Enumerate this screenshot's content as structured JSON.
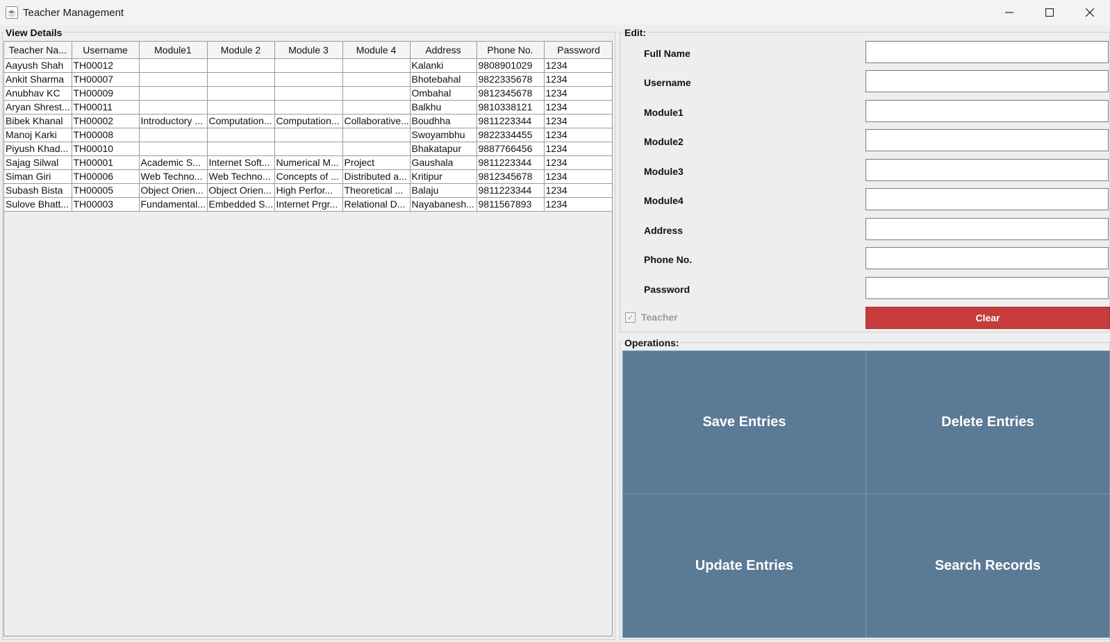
{
  "window": {
    "title": "Teacher Management",
    "app_icon": "java-cup-icon",
    "controls": [
      "minimize-icon",
      "maximize-icon",
      "close-icon"
    ]
  },
  "view_details": {
    "title": "View Details",
    "columns": [
      "Teacher Na...",
      "Username",
      "Module1",
      "Module 2",
      "Module 3",
      "Module 4",
      "Address",
      "Phone No.",
      "Password"
    ],
    "rows": [
      [
        "Aayush Shah",
        "TH00012",
        "",
        "",
        "",
        "",
        "Kalanki",
        "9808901029",
        "1234"
      ],
      [
        "Ankit Sharma",
        "TH00007",
        "",
        "",
        "",
        "",
        "Bhotebahal",
        "9822335678",
        "1234"
      ],
      [
        "Anubhav KC",
        "TH00009",
        "",
        "",
        "",
        "",
        "Ombahal",
        "9812345678",
        "1234"
      ],
      [
        "Aryan Shrest...",
        "TH00011",
        "",
        "",
        "",
        "",
        "Balkhu",
        "9810338121",
        "1234"
      ],
      [
        "Bibek Khanal",
        "TH00002",
        "Introductory ...",
        "Computation...",
        "Computation...",
        "Collaborative...",
        "Boudhha",
        "9811223344",
        "1234"
      ],
      [
        "Manoj Karki",
        "TH00008",
        "",
        "",
        "",
        "",
        "Swoyambhu",
        "9822334455",
        "1234"
      ],
      [
        "Piyush Khad...",
        "TH00010",
        "",
        "",
        "",
        "",
        "Bhakatapur",
        "9887766456",
        "1234"
      ],
      [
        "Sajag Silwal",
        "TH00001",
        "Academic S...",
        "Internet Soft...",
        "Numerical M...",
        "Project",
        "Gaushala",
        "9811223344",
        "1234"
      ],
      [
        "Siman Giri",
        "TH00006",
        "Web Techno...",
        "Web Techno...",
        "Concepts of ...",
        "Distributed a...",
        "Kritipur",
        "9812345678",
        "1234"
      ],
      [
        "Subash Bista",
        "TH00005",
        "Object Orien...",
        "Object Orien...",
        "High Perfor...",
        "Theoretical ...",
        "Balaju",
        "9811223344",
        "1234"
      ],
      [
        "Sulove Bhatt...",
        "TH00003",
        "Fundamental...",
        "Embedded S...",
        "Internet Prgr...",
        "Relational D...",
        "Nayabanesh...",
        "9811567893",
        "1234"
      ]
    ]
  },
  "edit": {
    "title": "Edit:",
    "fields": [
      {
        "label": "Full Name",
        "value": ""
      },
      {
        "label": "Username",
        "value": ""
      },
      {
        "label": "Module1",
        "value": ""
      },
      {
        "label": "Module2",
        "value": ""
      },
      {
        "label": "Module3",
        "value": ""
      },
      {
        "label": "Module4",
        "value": ""
      },
      {
        "label": "Address",
        "value": ""
      },
      {
        "label": "Phone No.",
        "value": ""
      },
      {
        "label": "Password",
        "value": ""
      }
    ],
    "teacher_checkbox": {
      "label": "Teacher",
      "checked": true,
      "enabled": false
    },
    "clear_label": "Clear",
    "clear_color": "#c63c3c"
  },
  "operations": {
    "title": "Operations:",
    "save_label": "Save Entries",
    "delete_label": "Delete Entries",
    "update_label": "Update Entries",
    "search_label": "Search Records",
    "button_color": "#5b7a96"
  }
}
